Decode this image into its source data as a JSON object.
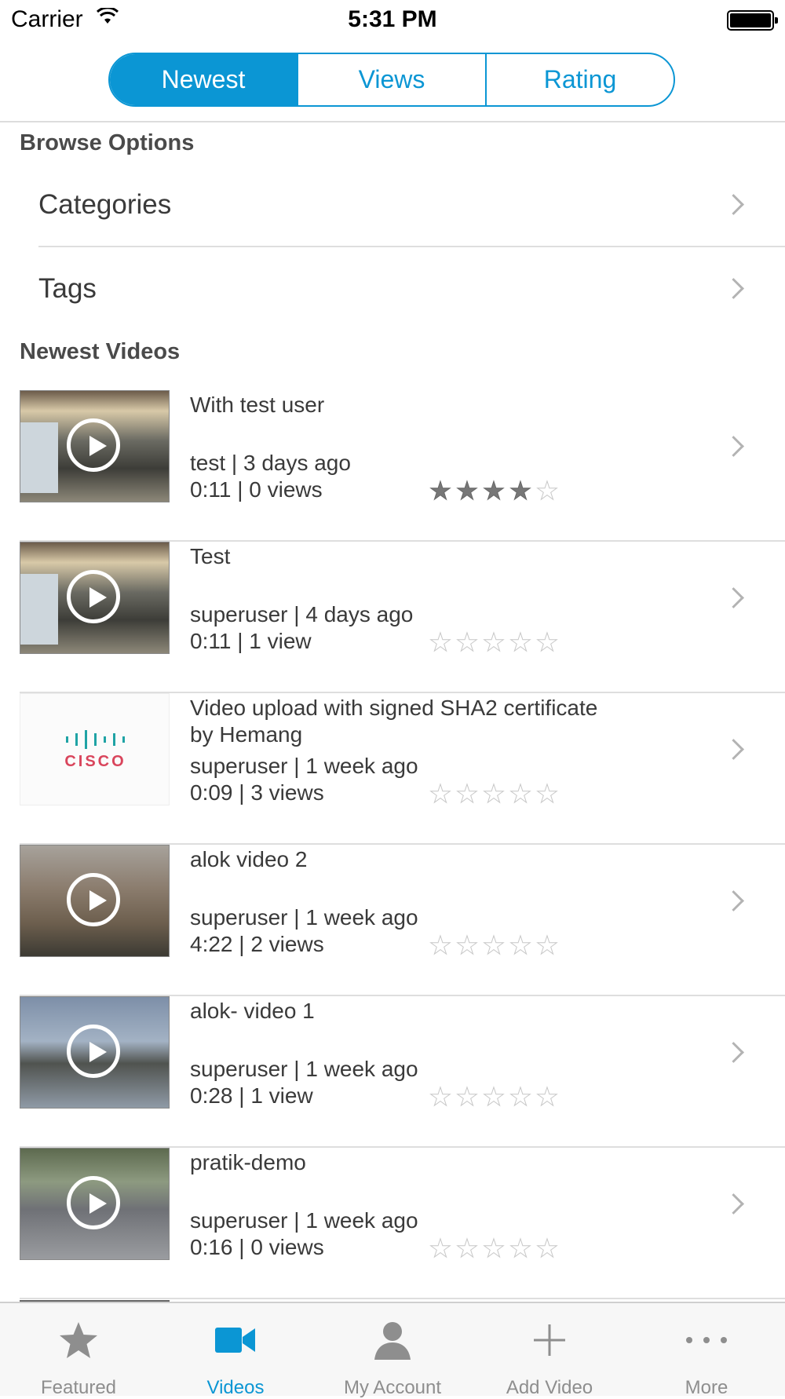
{
  "status_bar": {
    "carrier": "Carrier",
    "time": "5:31 PM"
  },
  "segments": [
    {
      "label": "Newest",
      "active": true
    },
    {
      "label": "Views",
      "active": false
    },
    {
      "label": "Rating",
      "active": false
    }
  ],
  "browse": {
    "title": "Browse Options",
    "items": [
      {
        "label": "Categories"
      },
      {
        "label": "Tags"
      }
    ]
  },
  "videos_section": {
    "title": "Newest Videos",
    "items": [
      {
        "title": "With test user",
        "byline": "test | 3 days ago",
        "stats": "0:11 | 0 views",
        "rating": 4,
        "thumb": "office"
      },
      {
        "title": "Test",
        "byline": "superuser | 4 days ago",
        "stats": "0:11 | 1 view",
        "rating": 0,
        "thumb": "office"
      },
      {
        "title": "Video upload with signed SHA2 certificate by Hemang",
        "byline": "superuser | 1 week ago",
        "stats": "0:09 | 3 views",
        "rating": 0,
        "thumb": "cisco",
        "thumb_text": "CISCO"
      },
      {
        "title": "alok video 2",
        "byline": "superuser | 1 week ago",
        "stats": "4:22 | 2 views",
        "rating": 0,
        "thumb": "tree"
      },
      {
        "title": "alok- video 1",
        "byline": "superuser | 1 week ago",
        "stats": "0:28 | 1 view",
        "rating": 0,
        "thumb": "rocks"
      },
      {
        "title": "pratik-demo",
        "byline": "superuser | 1 week ago",
        "stats": "0:16 | 0 views",
        "rating": 0,
        "thumb": "road"
      }
    ]
  },
  "tab_bar": {
    "items": [
      {
        "label": "Featured",
        "icon": "star-icon",
        "active": false
      },
      {
        "label": "Videos",
        "icon": "video-camera-icon",
        "active": true
      },
      {
        "label": "My Account",
        "icon": "person-icon",
        "active": false
      },
      {
        "label": "Add Video",
        "icon": "plus-icon",
        "active": false
      },
      {
        "label": "More",
        "icon": "more-dots-icon",
        "active": false
      }
    ]
  },
  "colors": {
    "accent": "#0b96d4",
    "inactive_tab": "#8e8e8e",
    "separator": "#dedede"
  }
}
